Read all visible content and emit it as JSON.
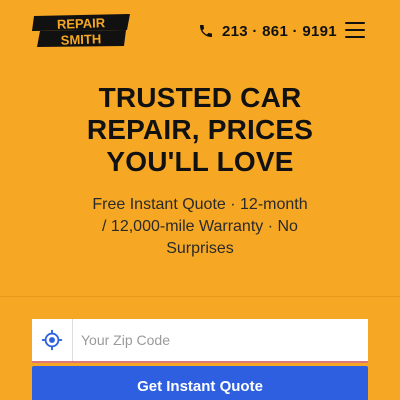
{
  "header": {
    "logo": {
      "line1": "REPAIR",
      "line2": "SMITH"
    },
    "phone": "213 · 861 · 9191",
    "icons": {
      "phone": "phone-icon",
      "menu": "hamburger-menu-icon"
    }
  },
  "hero": {
    "title_lines": [
      "TRUSTED CAR",
      "REPAIR, PRICES",
      "YOU'LL LOVE"
    ],
    "subtitle_lines": [
      "Free Instant Quote · 12-month",
      "/ 12,000-mile Warranty · No",
      "Surprises"
    ]
  },
  "form": {
    "zip_placeholder": "Your Zip Code",
    "zip_value": "",
    "location_icon": "location-target-icon",
    "submit_label": "Get Instant Quote"
  },
  "colors": {
    "background": "#f6a825",
    "button": "#2d5fe0",
    "text": "#111111",
    "logo_text": "#f6a825"
  }
}
